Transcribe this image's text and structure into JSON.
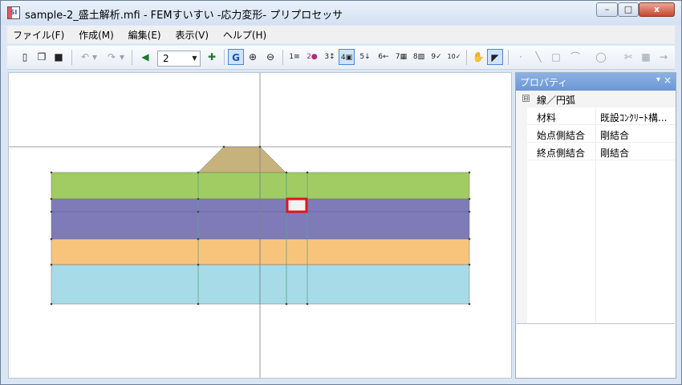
{
  "window": {
    "title": "sample-2_盛土解析.mfi - FEMすいすい -応力変形- プリプロセッサ",
    "app_icon": "SI",
    "min_label": "–",
    "max_label": "□",
    "close_label": "x"
  },
  "menu": [
    {
      "label": "ファイル(F)"
    },
    {
      "label": "作成(M)"
    },
    {
      "label": "編集(E)"
    },
    {
      "label": "表示(V)"
    },
    {
      "label": "ヘルプ(H)"
    }
  ],
  "toolbar": {
    "page_value": "2",
    "page_arrow": "▼",
    "glyphs": {
      "new": "▯",
      "open": "❐",
      "save": "■",
      "undo": "↶",
      "undo_menu": "▾",
      "redo": "↷",
      "redo_menu": "▾",
      "prev_page": "◀",
      "add_page": "✚",
      "grid": "G",
      "zoom_in": "⊕",
      "zoom_out": "⊖",
      "t1": "1≡",
      "t2": "2●",
      "t3": "3↕",
      "t4": "4▣",
      "t5": "5↓",
      "t6": "6←",
      "t7": "7▦",
      "t8": "8▧",
      "t9": "9✓",
      "t10": "10✓",
      "pan": "✋",
      "select": "◤",
      "point": "·",
      "line": "╲",
      "rect": "□",
      "arc": "⌒",
      "shape": "◯",
      "erase": "✄",
      "mesh": "▦",
      "go": "→"
    }
  },
  "canvas": {
    "colors": {
      "embankment": "#c6b27a",
      "green": "#a0cc63",
      "purple": "#7e7bb8",
      "orange": "#f8c47c",
      "cyan": "#a8dbe8",
      "highlight": "#e0141e",
      "guide": "#808080"
    }
  },
  "properties": {
    "header": "プロパティ",
    "pin_label": "▾",
    "close_label": "×",
    "collapse": "⊟",
    "category": "線／円弧",
    "rows": [
      {
        "key": "材料",
        "value": "既設ｺﾝｸﾘｰﾄ構..."
      },
      {
        "key": "始点側結合",
        "value": "剛結合"
      },
      {
        "key": "終点側結合",
        "value": "剛結合"
      }
    ]
  }
}
